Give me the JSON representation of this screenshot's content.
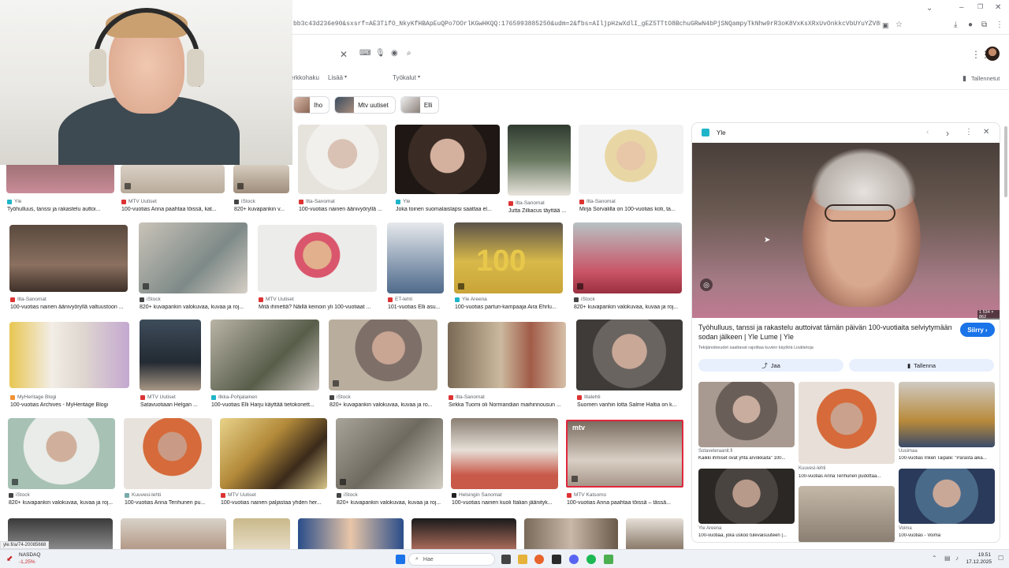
{
  "browser": {
    "url": "bb3c43d236e90&sxsrf=AE3TifO_NkyKfHBApEuQPo7OOrlKGwHKQQ:1765993885250&udm=2&fbs=AIljpHzwXdlI_gEZ5TTtO8BchuGRwN4bPjSNQampyTkNhw9rR3oK8VxKsXRxUvOnkkcVbUYuYZV8NfWZ13XkGBJfrKy3bFXDLQDzIZ1QZ14qR5tBy"
  },
  "search": {
    "menu": [
      "erkkohaku",
      "Lisää"
    ],
    "tools": "Työkalut",
    "saved": "Tallennetut"
  },
  "chips": [
    "Iho",
    "Mtv uutiset",
    "Elli"
  ],
  "grid_top": [
    {
      "source": "Yle",
      "caption": "Työhulluus, tanssi ja rakastelu auttoi..."
    },
    {
      "source": "MTV Uutiset",
      "caption": "100-vuotias Anna paahtaa töissä, kat..."
    },
    {
      "source": "iStock",
      "caption": "820+ kuvapankin v..."
    },
    {
      "source": "Ilta-Sanomat",
      "caption": "100-vuotias nainen äänivyöryllä ..."
    },
    {
      "source": "Yle",
      "caption": "Joka toinen suomalaislapsi saattaa el..."
    },
    {
      "source": "Ilta-Sanomat",
      "caption": "Jutta Zilliacus täyttää ..."
    },
    {
      "source": "Ilta-Sanomat",
      "caption": "Mirja Sorvalilla on 100-vuotias koti, ta..."
    }
  ],
  "grid_row2": [
    {
      "source": "Ilta-Sanomat",
      "caption": "100-vuotias nainen äänivyöryllä valtuustoon ..."
    },
    {
      "source": "iStock",
      "caption": "820+ kuvapankin valokuvaa, kuvaa ja roj..."
    },
    {
      "source": "MTV Uutiset",
      "caption": "Mitä ihmettä? Näillä keinoin yli 100-vuotiaat ..."
    },
    {
      "source": "ET-lehti",
      "caption": "101-vuotias Elli asu..."
    },
    {
      "source": "Yle Areena",
      "caption": "100-vuotias parturi-kampaaja Aira Ehrlu..."
    },
    {
      "source": "iStock",
      "caption": "820+ kuvapankin valokuvaa, kuvaa ja roj..."
    }
  ],
  "grid_row3": [
    {
      "source": "MyHeritage Blogi",
      "caption": "100-vuotias Archives - MyHeritage Blogi"
    },
    {
      "source": "MTV Uutiset",
      "caption": "Satavuotiaan Helgan ..."
    },
    {
      "source": "Ilkka-Pohjalainen",
      "caption": "100-vuotias Elli Harju käyttää tietokonett..."
    },
    {
      "source": "iStock",
      "caption": "820+ kuvapankin valokuvaa, kuvaa ja ro..."
    },
    {
      "source": "Ilta-Sanomat",
      "caption": "Sirkka Tuomi oli Normandian maihinnousun ..."
    },
    {
      "source": "Iltalehti",
      "caption": "Suomen vanhin lotta Salme Haltia on k..."
    }
  ],
  "grid_row4": [
    {
      "source": "iStock",
      "caption": "820+ kuvapankin valokuvaa, kuvaa ja roj..."
    },
    {
      "source": "Kuuvesi-lehti",
      "caption": "100-vuotias Anna Tenhunen pu..."
    },
    {
      "source": "MTV Uutiset",
      "caption": "100-vuotias nainen paljastaa yhden her..."
    },
    {
      "source": "iStock",
      "caption": "820+ kuvapankin valokuvaa, kuvaa ja roj..."
    },
    {
      "source": "Helsingin Sanomat",
      "caption": "100-vuotias nainen kuoli Italian jäänityk..."
    },
    {
      "source": "MTV Katsomo",
      "caption": "100-vuotias Anna paahtaa töissä – tässä..."
    }
  ],
  "panel": {
    "source": "Yle",
    "dimensions": "1 534 × 862",
    "title": "Työhulluus, tanssi ja rakastelu auttoivat tämän päivän 100-vuotiaita selviytymään sodan jälkeen | Yle Lume | Yle",
    "rights": "Tekijänoikeudet saattavat rajoittaa kuvien käyttöä",
    "more_info": "Lisätietoja",
    "visit": "Siirry",
    "share": "Jaa",
    "save": "Tallenna",
    "related": [
      {
        "source": "Sotaveteraanit.fi",
        "caption": "Kaikki ihmiset ovat yhtä arvokkaita\" 100..."
      },
      {
        "source": "Kuuvesi-lehti",
        "caption": "100-vuotias Anna Tenhunen pudottaa..."
      },
      {
        "source": "Uusimaa",
        "caption": "100-vuotias Inkeri Taipale: \"Parasta aika..."
      },
      {
        "source": "Yle Areena",
        "caption": "100-vuotiaa, joka uskoo tulevaisuuteen |..."
      },
      {
        "source": "",
        "caption": ""
      },
      {
        "source": "Voima",
        "caption": "100-vuotias - Voima"
      }
    ]
  },
  "status_url": "yle.fi/a/74-20085668",
  "taskbar": {
    "ticker_name": "NASDAQ",
    "ticker_value": "-1,25%",
    "search_placeholder": "Hae",
    "time": "19.51",
    "date": "17.12.2025"
  },
  "colors": {
    "accent": "#1a73e8",
    "panel_button_bg": "#e8f0fe",
    "mtv_frame": "#e0283c"
  }
}
